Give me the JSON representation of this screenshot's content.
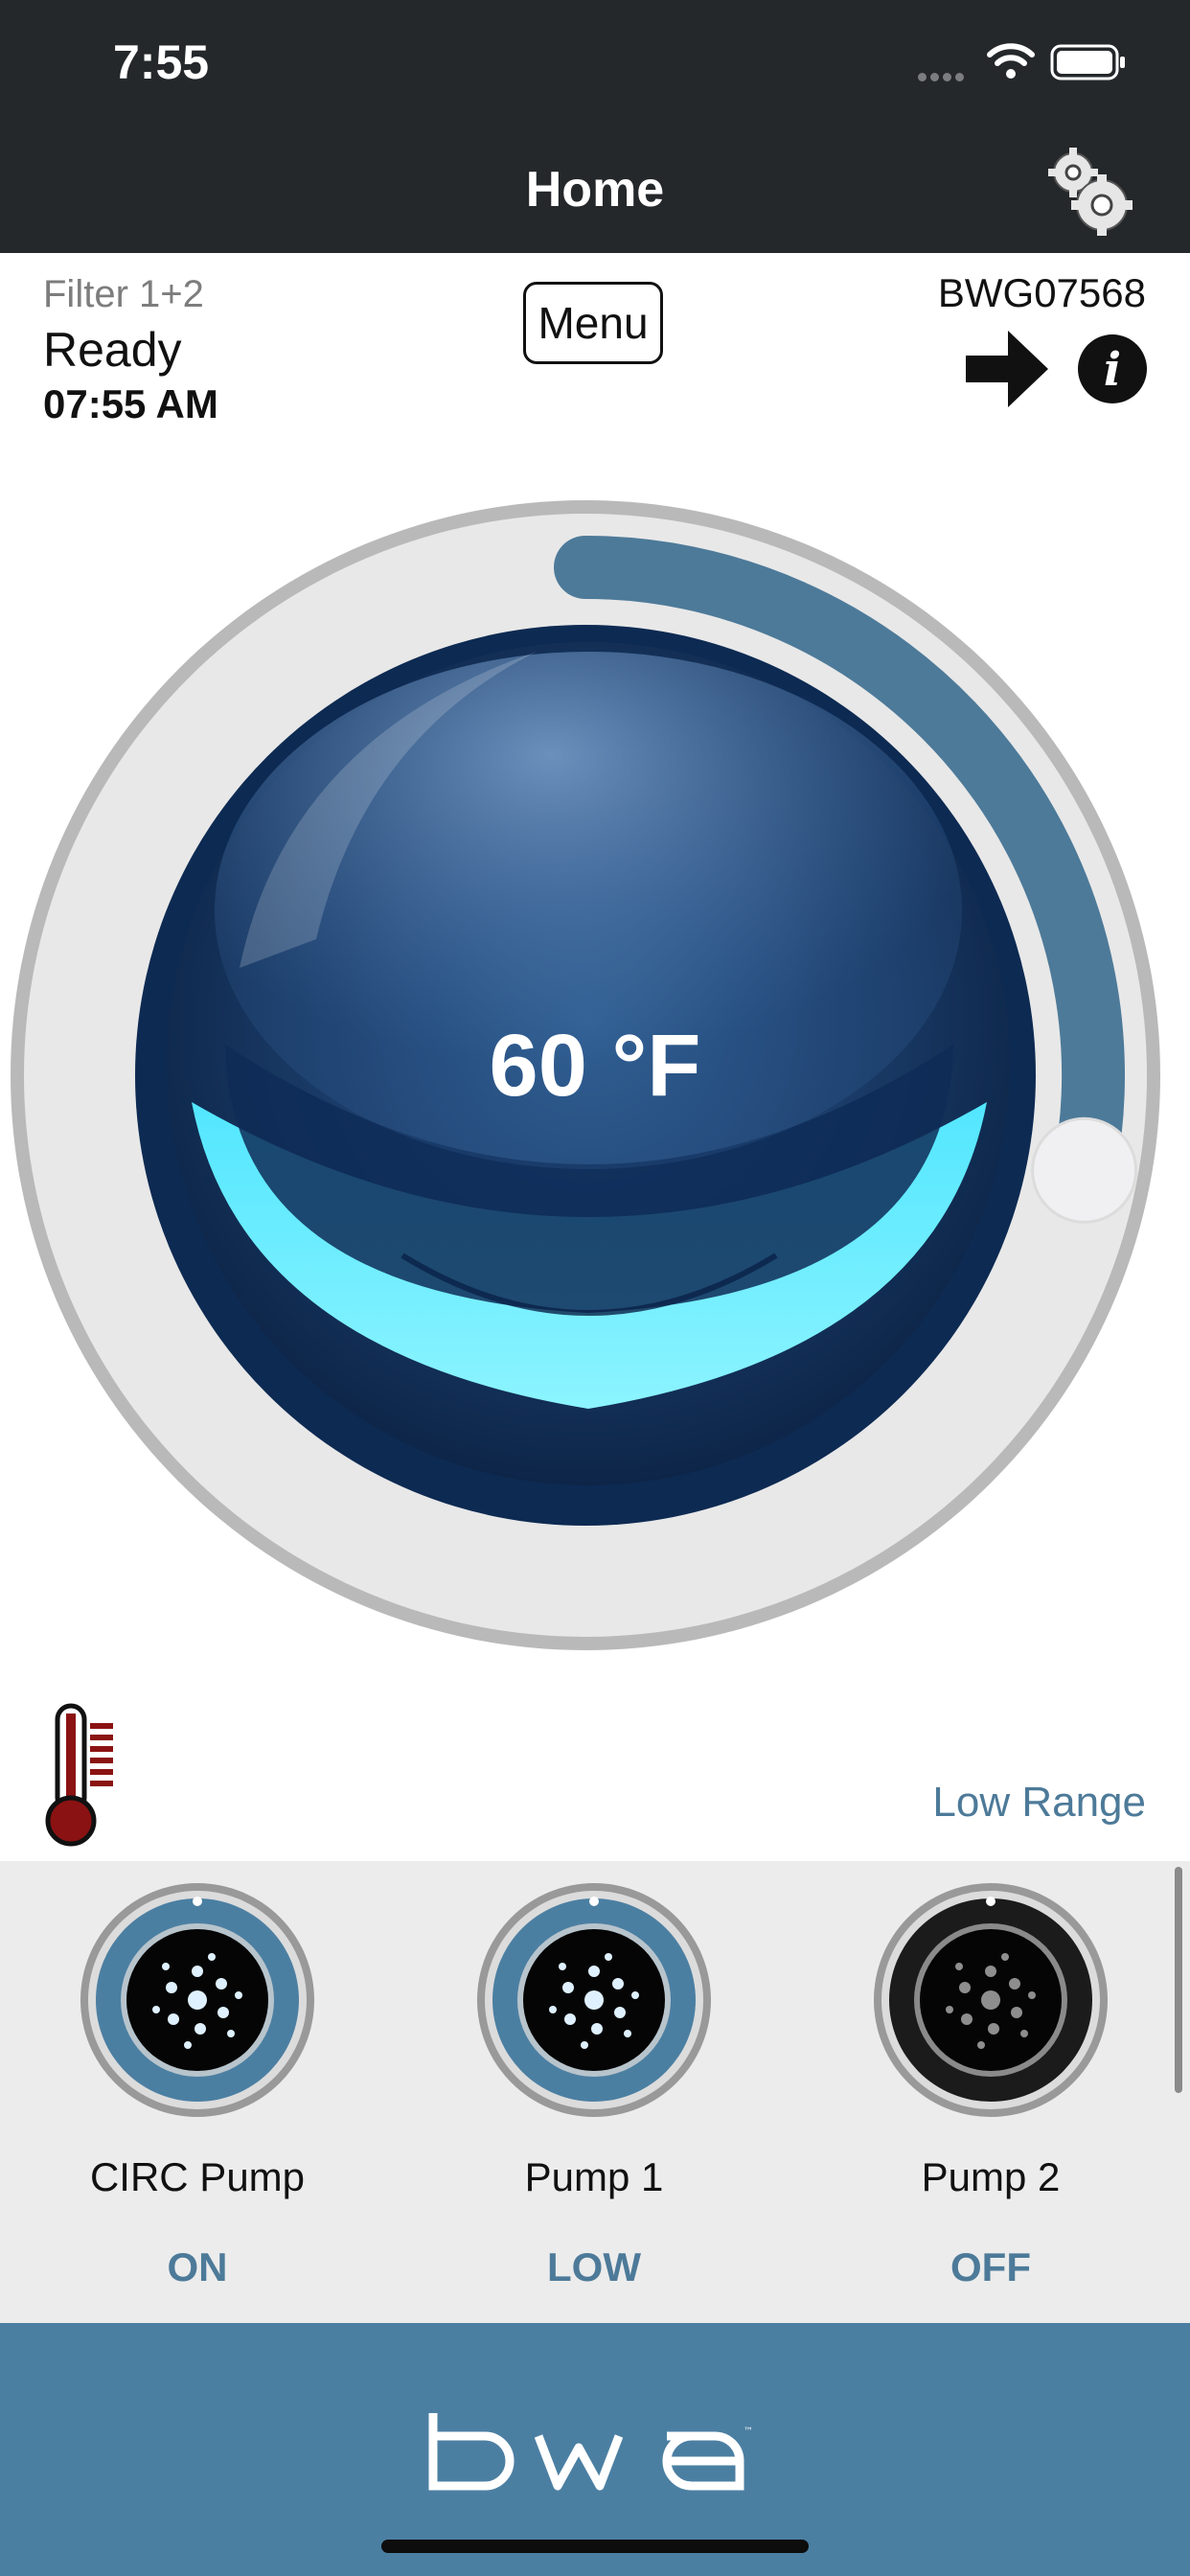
{
  "status_bar": {
    "time": "7:55"
  },
  "header": {
    "title": "Home"
  },
  "info": {
    "filter": "Filter 1+2",
    "state": "Ready",
    "time": "07:55 AM",
    "menu_label": "Menu",
    "device_id": "BWG07568"
  },
  "dial": {
    "temperature": "60 °F",
    "set_level": 0.28
  },
  "range": {
    "label": "Low Range"
  },
  "pumps": [
    {
      "name": "CIRC Pump",
      "state": "ON",
      "active": true
    },
    {
      "name": "Pump 1",
      "state": "LOW",
      "active": true
    },
    {
      "name": "Pump 2",
      "state": "OFF",
      "active": false
    }
  ],
  "footer": {
    "logo": "bwa"
  },
  "colors": {
    "header_bg": "#25282b",
    "accent": "#4d7a99",
    "footer_bg": "#4b7fa2",
    "thermo_red": "#8b1212"
  },
  "icons": [
    "settings-gear-icon",
    "arrow-right-icon",
    "info-icon",
    "thermometer-icon",
    "jet-pump-icon",
    "wifi-icon",
    "battery-icon"
  ]
}
